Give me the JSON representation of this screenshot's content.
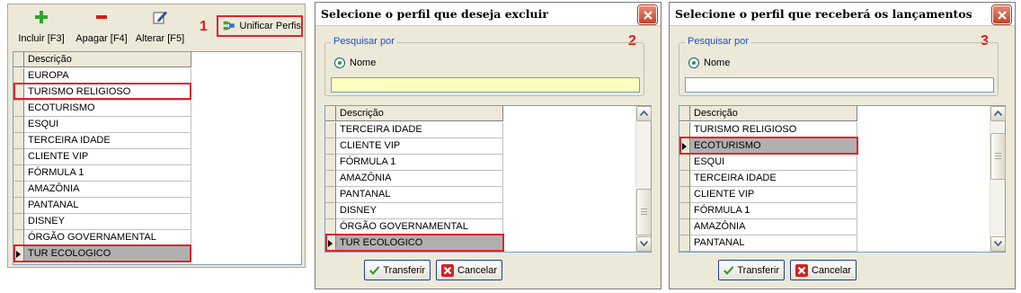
{
  "panel1": {
    "toolbar": {
      "incluir": "Incluir [F3]",
      "apagar": "Apagar [F4]",
      "alterar": "Alterar [F5]",
      "unificar": "Unificar Perfis",
      "step": "1"
    },
    "grid": {
      "header": "Descrição",
      "rows": [
        "EUROPA",
        "TURISMO RELIGIOSO",
        "ECOTURISMO",
        "ESQUI",
        "TERCEIRA IDADE",
        "CLIENTE VIP",
        "FÓRMULA 1",
        "AMAZÔNIA",
        "PANTANAL",
        "DISNEY",
        "ÓRGÃO GOVERNAMENTAL",
        "TUR ECOLOGICO"
      ]
    }
  },
  "dialog2": {
    "title": "Selecione o perfil que deseja excluir",
    "step": "2",
    "search_legend": "Pesquisar por",
    "radio_label": "Nome",
    "search_value": "",
    "grid": {
      "header": "Descrição",
      "rows": [
        "TERCEIRA IDADE",
        "CLIENTE VIP",
        "FÓRMULA 1",
        "AMAZÔNIA",
        "PANTANAL",
        "DISNEY",
        "ÓRGÃO GOVERNAMENTAL",
        "TUR ECOLOGICO"
      ]
    },
    "transferir": "Transferir",
    "cancelar": "Cancelar"
  },
  "dialog3": {
    "title": "Selecione o perfil que receberá os lançamentos",
    "step": "3",
    "search_legend": "Pesquisar por",
    "radio_label": "Nome",
    "search_value": "",
    "grid": {
      "header": "Descrição",
      "rows": [
        "TURISMO RELIGIOSO",
        "ECOTURISMO",
        "ESQUI",
        "TERCEIRA IDADE",
        "CLIENTE VIP",
        "FÓRMULA 1",
        "AMAZÔNIA",
        "PANTANAL"
      ]
    },
    "transferir": "Transferir",
    "cancelar": "Cancelar"
  },
  "colors": {
    "highlight": "#e0242c",
    "window_bg": "#ece9d8",
    "selected_row": "#b0b0b0",
    "search_yellow": "#ffffc0",
    "legend_blue": "#1c4fc9"
  }
}
